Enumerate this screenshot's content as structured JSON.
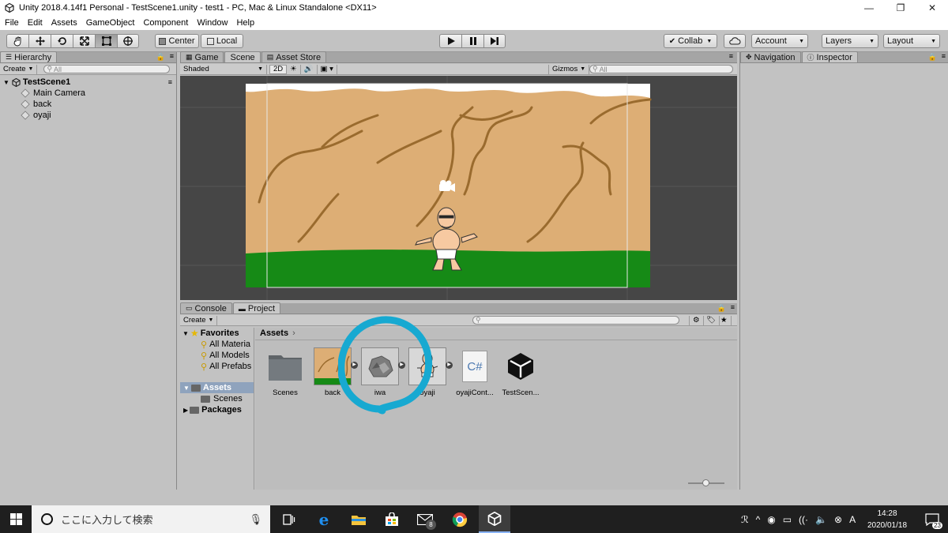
{
  "window": {
    "title": "Unity 2018.4.14f1 Personal - TestScene1.unity - test1 - PC, Mac & Linux Standalone <DX11>",
    "minimize": "—",
    "maximize": "❐",
    "close": "✕"
  },
  "menu": [
    "File",
    "Edit",
    "Assets",
    "GameObject",
    "Component",
    "Window",
    "Help"
  ],
  "toolbar": {
    "tools": [
      "hand-tool-icon",
      "move-tool-icon",
      "rotate-tool-icon",
      "scale-tool-icon",
      "rect-tool-icon",
      "transform-tool-icon"
    ],
    "pivot_label": "Center",
    "space_label": "Local",
    "collab_label": "Collab",
    "account_label": "Account",
    "layers_label": "Layers",
    "layout_label": "Layout"
  },
  "hierarchy": {
    "tab": "Hierarchy",
    "create": "Create",
    "search_placeholder": "All",
    "scene": "TestScene1",
    "items": [
      "Main Camera",
      "back",
      "oyaji"
    ]
  },
  "scene_panel": {
    "tabs": [
      "Game",
      "Scene",
      "Asset Store"
    ],
    "active_tab": "Scene",
    "shading": "Shaded",
    "mode_2d": "2D",
    "gizmos": "Gizmos",
    "search_placeholder": "All"
  },
  "project": {
    "tabs": [
      "Console",
      "Project"
    ],
    "active_tab": "Project",
    "create": "Create",
    "breadcrumb": "Assets",
    "favorites": {
      "label": "Favorites",
      "items": [
        "All Materia",
        "All Models",
        "All Prefabs"
      ]
    },
    "tree": {
      "assets": "Assets",
      "scenes": "Scenes",
      "packages": "Packages"
    },
    "assets": [
      {
        "name": "Scenes",
        "kind": "folder"
      },
      {
        "name": "back",
        "kind": "sprite"
      },
      {
        "name": "iwa",
        "kind": "sprite"
      },
      {
        "name": "oyaji",
        "kind": "sprite"
      },
      {
        "name": "oyajiCont...",
        "kind": "script",
        "glyph": "C#"
      },
      {
        "name": "TestScen...",
        "kind": "scene"
      }
    ]
  },
  "right_panel": {
    "tabs": [
      "Navigation",
      "Inspector"
    ],
    "active_tab": "Inspector"
  },
  "taskbar": {
    "search_placeholder": "ここに入力して検索",
    "mail_badge": "8",
    "time": "14:28",
    "date": "2020/01/18",
    "notif_count": "23"
  },
  "colors": {
    "highlight_circle": "#17a9d1",
    "sky": "#ffffff",
    "cliff": "#ddae75",
    "cliff_line": "#9a6b2e",
    "grass": "#168a16"
  }
}
